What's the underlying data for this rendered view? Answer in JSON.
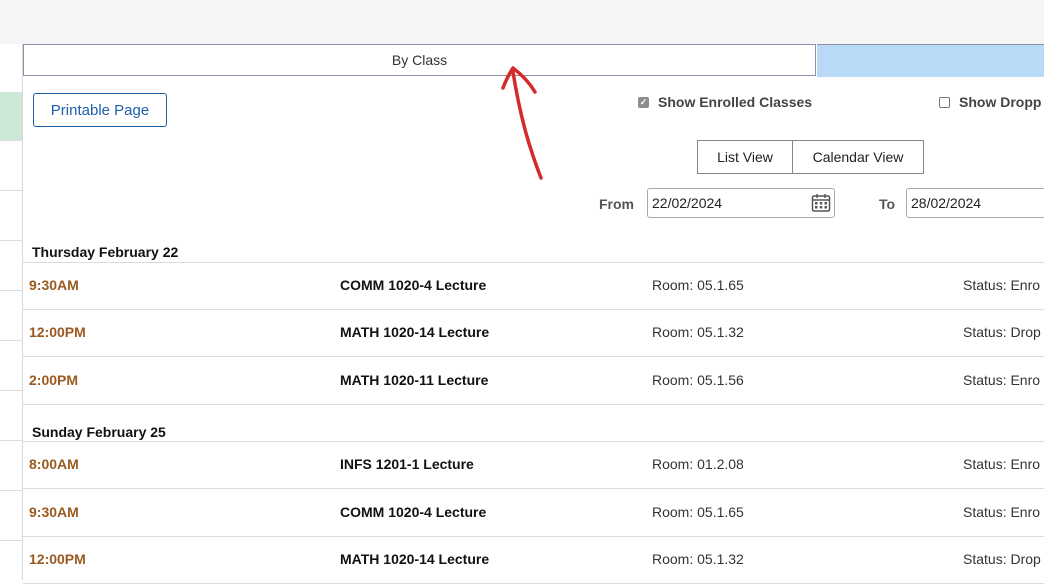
{
  "tabs": {
    "by_class": "By Class"
  },
  "toolbar": {
    "printable_label": "Printable Page"
  },
  "filters": {
    "show_enrolled": {
      "label": "Show Enrolled Classes",
      "checked": true
    },
    "show_dropped": {
      "label": "Show Dropp",
      "checked": false
    }
  },
  "views": {
    "list": "List View",
    "calendar": "Calendar View"
  },
  "range": {
    "from_label": "From",
    "from_value": "22/02/2024",
    "to_label": "To",
    "to_value": "28/02/2024"
  },
  "days": [
    {
      "header": "Thursday February 22",
      "rows": [
        {
          "time": "9:30AM",
          "class": "COMM 1020-4 Lecture",
          "room": "Room: 05.1.65",
          "status": "Status: Enro"
        },
        {
          "time": "12:00PM",
          "class": "MATH 1020-14 Lecture",
          "room": "Room: 05.1.32",
          "status": "Status: Drop"
        },
        {
          "time": "2:00PM",
          "class": "MATH 1020-11 Lecture",
          "room": "Room: 05.1.56",
          "status": "Status: Enro"
        }
      ]
    },
    {
      "header": "Sunday February 25",
      "rows": [
        {
          "time": "8:00AM",
          "class": "INFS 1201-1 Lecture",
          "room": "Room: 01.2.08",
          "status": "Status: Enro"
        },
        {
          "time": "9:30AM",
          "class": "COMM 1020-4 Lecture",
          "room": "Room: 05.1.65",
          "status": "Status: Enro"
        },
        {
          "time": "12:00PM",
          "class": "MATH 1020-14 Lecture",
          "room": "Room: 05.1.32",
          "status": "Status: Drop"
        }
      ]
    }
  ],
  "colors": {
    "time_text": "#9a5a1f",
    "active_tab": "#b9daf7",
    "link_blue": "#1f5fa8",
    "annotation_red": "#d42a2a"
  },
  "icons": {
    "calendar": "calendar-icon",
    "annotation": "red-arrow-annotation"
  }
}
